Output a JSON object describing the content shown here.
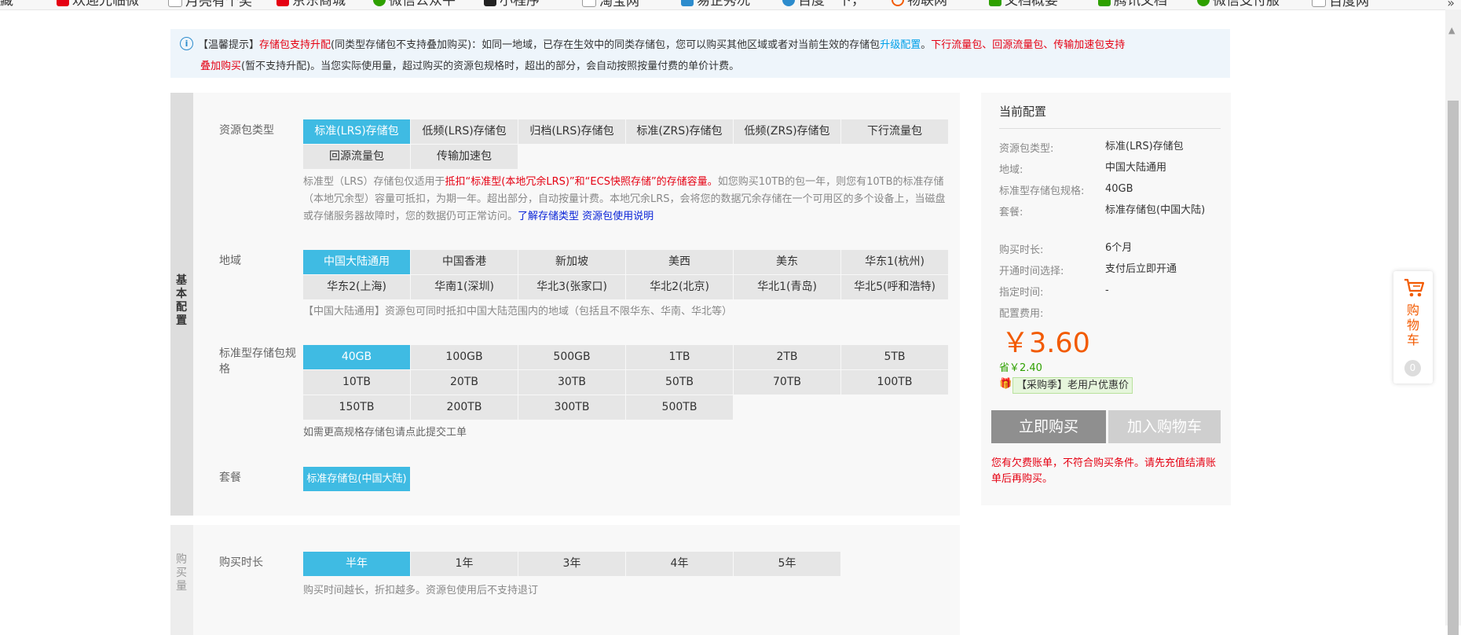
{
  "bookmarks": [
    {
      "label": "藏",
      "icon": "bookmark-star-icon",
      "color": "#333333"
    },
    {
      "label": "欢迎光临微",
      "icon": "tmall-icon",
      "color": "#e50012"
    },
    {
      "label": "月亮有个奖",
      "icon": "folder-icon",
      "color": "#999999"
    },
    {
      "label": "京东商城",
      "icon": "jd-icon",
      "color": "#e50012"
    },
    {
      "label": "微信公众平",
      "icon": "wechat-cloud-icon",
      "color": "#2ea000"
    },
    {
      "label": "小程序",
      "icon": "miniprogram-icon",
      "color": "#333333"
    },
    {
      "label": "淘宝网",
      "icon": "folder-icon",
      "color": "#999999"
    },
    {
      "label": "易企秀况",
      "icon": "eqxiu-icon",
      "color": "#2d8ccd"
    },
    {
      "label": "百度一下，",
      "icon": "baidu-icon",
      "color": "#2d8ccd"
    },
    {
      "label": "物联网",
      "icon": "iot-icon",
      "color": "#f25a00"
    },
    {
      "label": "文档概要",
      "icon": "doc-icon",
      "color": "#2ea000"
    },
    {
      "label": "腾讯文档",
      "icon": "tencent-doc-icon",
      "color": "#2ea000"
    },
    {
      "label": "微信支付服",
      "icon": "wechat-pay-icon",
      "color": "#2ea000"
    },
    {
      "label": "百度网",
      "icon": "folder-icon",
      "color": "#999999"
    }
  ],
  "notice": {
    "prefix": "【温馨提示】",
    "red1": "存储包支持升配",
    "t1": "(同类型存储包不支持叠加购买)：如同一地域，已存在生效中的同类存储包，您可以购买其他区域或者对当前生效的存储包",
    "link": "升级配置",
    "t2": "。",
    "red2": "下行流量包、回源流量包、传输加速包支持",
    "red3": "叠加购买",
    "t3": "(暂不支持升配)。当您实际使用量，超过购买的资源包规格时，超出的部分，会自动按照按量付费的单价计费。"
  },
  "config": {
    "side_label": "基本配置",
    "type_label": "资源包类型",
    "types": [
      "标准(LRS)存储包",
      "低频(LRS)存储包",
      "归档(LRS)存储包",
      "标准(ZRS)存储包",
      "低频(ZRS)存储包",
      "下行流量包",
      "回源流量包",
      "传输加速包"
    ],
    "type_desc": {
      "a": "标准型（LRS）存储包仅适用于",
      "b": "抵扣“标准型(本地冗余LRS)”和“ECS快照存储”的存储容量。",
      "c": "如您购买10TB的包一年，则您有10TB的标准存储（本地冗余型）容量可抵扣，为期一年。超出部分，自动按量计费。本地冗余LRS，会将您的数据冗余存储在一个可用区的多个设备上，当磁盘或存储服务器故障时，您的数据仍可正常访问。",
      "link": "了解存储类型 资源包使用说明"
    },
    "region_label": "地域",
    "regions": [
      "中国大陆通用",
      "中国香港",
      "新加坡",
      "美西",
      "美东",
      "华东1(杭州)",
      "华东2(上海)",
      "华南1(深圳)",
      "华北3(张家口)",
      "华北2(北京)",
      "华北1(青岛)",
      "华北5(呼和浩特)"
    ],
    "region_desc": "【中国大陆通用】资源包可同时抵扣中国大陆范围内的地域（包括且不限华东、华南、华北等）",
    "size_label": "标准型存储包规格",
    "sizes": [
      "40GB",
      "100GB",
      "500GB",
      "1TB",
      "2TB",
      "5TB",
      "10TB",
      "20TB",
      "30TB",
      "50TB",
      "70TB",
      "100TB",
      "150TB",
      "200TB",
      "300TB",
      "500TB"
    ],
    "size_desc": "如需更高规格存储包请点此提交工单",
    "plan_label": "套餐",
    "plans": [
      "标准存储包(中国大陆)"
    ]
  },
  "purchase": {
    "side_label": "购买量",
    "duration_label": "购买时长",
    "durations": [
      "半年",
      "1年",
      "3年",
      "4年",
      "5年"
    ],
    "duration_desc": "购买时间越长，折扣越多。资源包使用后不支持退订"
  },
  "summary": {
    "title": "当前配置",
    "rows": [
      {
        "k": "资源包类型:",
        "v": "标准(LRS)存储包"
      },
      {
        "k": "地域:",
        "v": "中国大陆通用"
      },
      {
        "k": "标准型存储包规格:",
        "v": "40GB"
      },
      {
        "k": "套餐:",
        "v": "标准存储包(中国大陆)"
      },
      {
        "k": "购买时长:",
        "v": "6个月"
      },
      {
        "k": "开通时间选择:",
        "v": "支付后立即开通"
      },
      {
        "k": "指定时间:",
        "v": "-"
      },
      {
        "k": "配置费用:",
        "v": ""
      }
    ],
    "price": "￥3.60",
    "save": "省￥2.40",
    "promo": "【采购季】老用户优惠价",
    "buy_label": "立即购买",
    "cart_label": "加入购物车",
    "warning": "您有欠费账单，不符合购买条件。请先充值结清账单后再购买。"
  },
  "float_cart": {
    "label": "购物车",
    "count": "0"
  },
  "colors": {
    "accent": "#3fbbe3",
    "price": "#f25a00",
    "warning": "#e50012",
    "link": "#00a0e9"
  }
}
